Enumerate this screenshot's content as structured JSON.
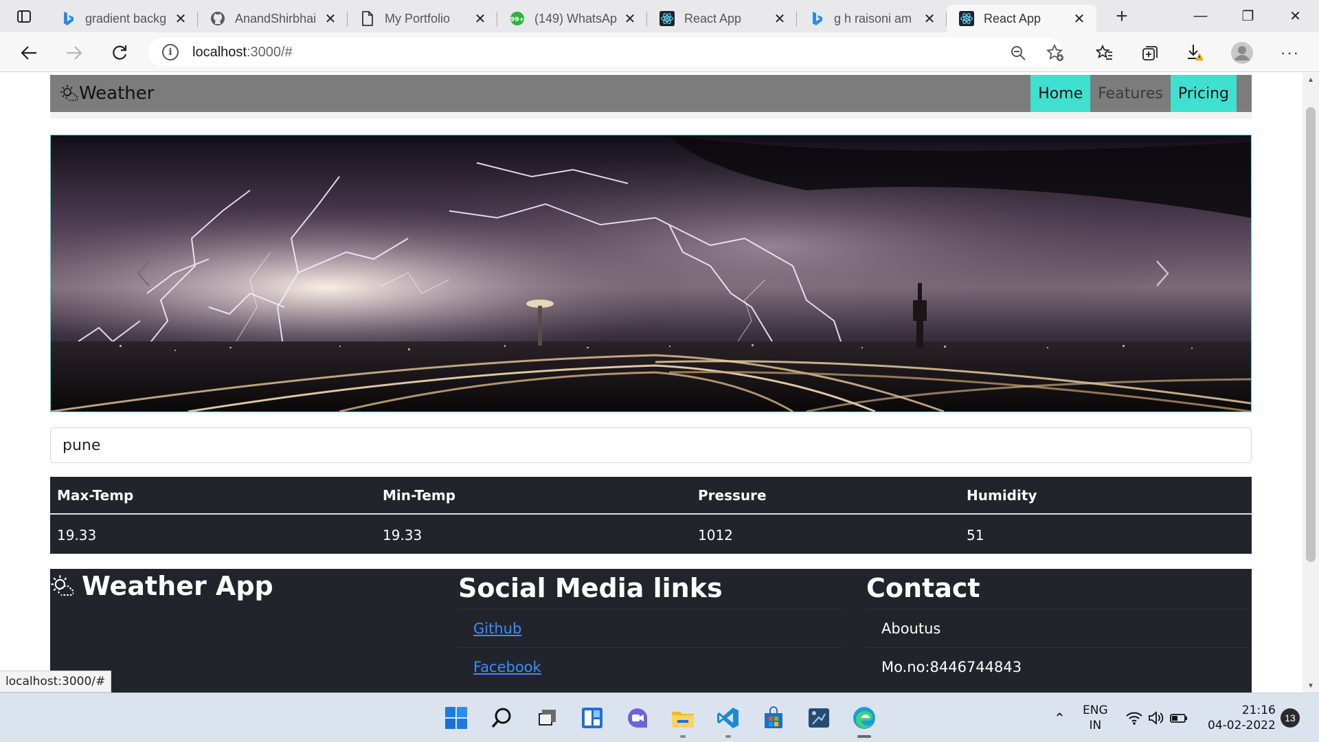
{
  "browser": {
    "tabs": [
      {
        "title": "gradient backg",
        "icon": "bing-icon",
        "active": false
      },
      {
        "title": "AnandShirbhai",
        "icon": "github-icon",
        "active": false
      },
      {
        "title": "My Portfolio",
        "icon": "page-icon",
        "active": false
      },
      {
        "title": "(149) WhatsAp",
        "icon": "whatsapp-icon",
        "active": false
      },
      {
        "title": "React App",
        "icon": "react-icon",
        "active": false
      },
      {
        "title": "g h raisoni am",
        "icon": "bing-icon",
        "active": false
      },
      {
        "title": "React App",
        "icon": "react-icon",
        "active": true
      }
    ],
    "url_host": "localhost",
    "url_path": ":3000/#",
    "status_url": "localhost:3000/#"
  },
  "navbar": {
    "brand": "Weather",
    "links": [
      {
        "label": "Home",
        "highlighted": true
      },
      {
        "label": "Features",
        "highlighted": false
      },
      {
        "label": "Pricing",
        "highlighted": true
      }
    ],
    "highlight_color": "#40e0d0"
  },
  "search": {
    "value": "pune"
  },
  "weather_table": {
    "headers": [
      "Max-Temp",
      "Min-Temp",
      "Pressure",
      "Humidity"
    ],
    "rows": [
      [
        "19.33",
        "19.33",
        "1012",
        "51"
      ]
    ]
  },
  "footer": {
    "brand": "Weather App",
    "social_heading": "Social Media links",
    "social_links": [
      "Github",
      "Facebook"
    ],
    "contact_heading": "Contact",
    "contact_items": [
      "Aboutus",
      "Mo.no:8446744843"
    ]
  },
  "taskbar": {
    "apps": [
      "windows-start-icon",
      "search-icon",
      "task-view-icon",
      "widgets-icon",
      "teams-chat-icon",
      "file-explorer-icon",
      "vscode-icon",
      "microsoft-store-icon",
      "snipping-tool-icon",
      "edge-icon"
    ],
    "language_line1": "ENG",
    "language_line2": "IN",
    "time": "21:16",
    "date": "04-02-2022",
    "notification_count": "13"
  }
}
